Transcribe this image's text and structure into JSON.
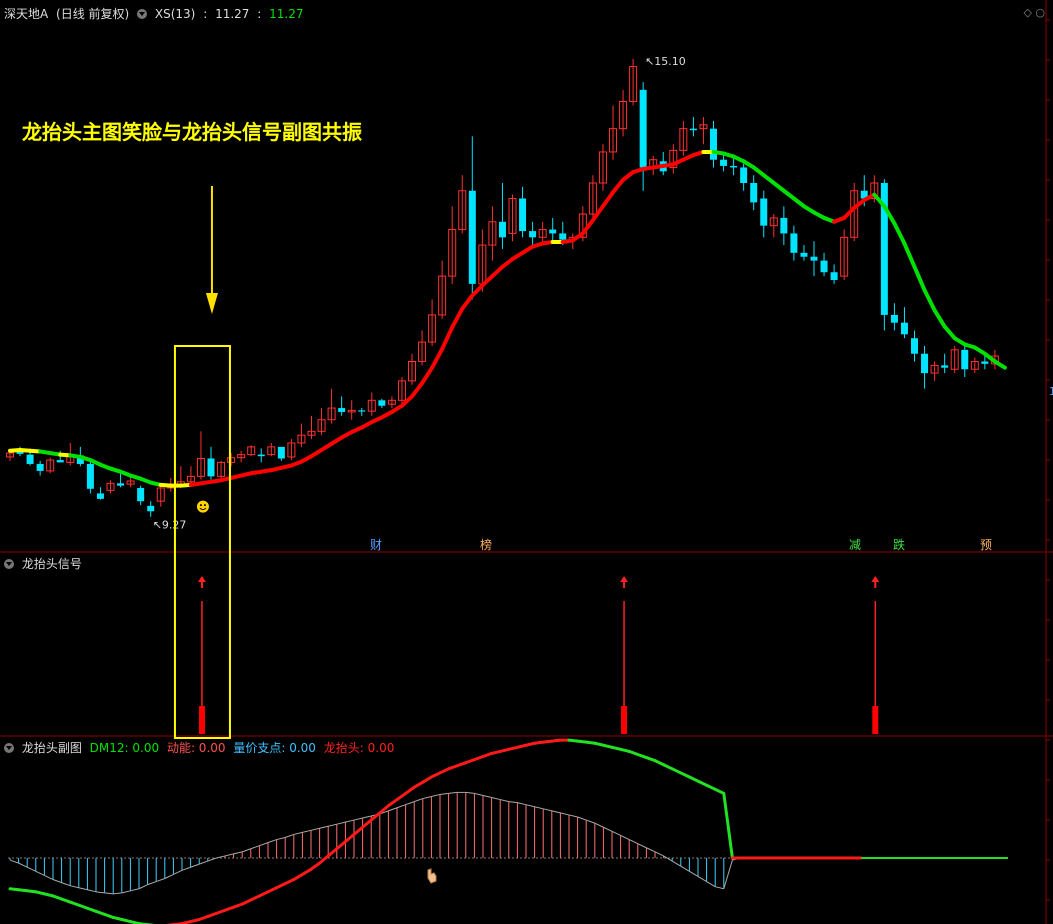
{
  "header": {
    "stock_name": "深天地A",
    "period": "(日线 前复权)",
    "indicator_name": "XS(13)",
    "indicator_values": [
      "11.27",
      "11.27"
    ]
  },
  "annotation": "龙抬头主图笑脸与龙抬头信号副图共振",
  "high_label": "15.10",
  "low_label": "9.27",
  "events": [
    "财",
    "榜",
    "减",
    "跌",
    "预"
  ],
  "right_tag": "1",
  "panel2": {
    "title": "龙抬头信号"
  },
  "panel3": {
    "title": "龙抬头副图",
    "legend": [
      {
        "label": "DM12: 0.00",
        "color": "#00e000"
      },
      {
        "label": "动能: 0.00",
        "color": "#ff5050"
      },
      {
        "label": "量价支点: 0.00",
        "color": "#40c0ff"
      },
      {
        "label": "龙抬头: 0.00",
        "color": "#ff2020"
      }
    ]
  },
  "colors": {
    "up": "#ff3030",
    "down": "#00e5ff",
    "ma_up": "#ff0000",
    "ma_down": "#00e000",
    "ma_flat": "#ffff00",
    "box": "#ffff00"
  },
  "chart_data": {
    "type": "candlestick",
    "ylim": [
      8.9,
      15.6
    ],
    "candles": [
      [
        9.97,
        10.05,
        9.92,
        10.02
      ],
      [
        10.05,
        10.1,
        9.98,
        10.01
      ],
      [
        10.0,
        10.04,
        9.86,
        9.88
      ],
      [
        9.88,
        9.92,
        9.73,
        9.79
      ],
      [
        9.79,
        9.96,
        9.76,
        9.93
      ],
      [
        9.93,
        10.05,
        9.9,
        9.9
      ],
      [
        9.9,
        10.15,
        9.86,
        9.98
      ],
      [
        9.99,
        10.1,
        9.85,
        9.88
      ],
      [
        9.88,
        9.95,
        9.5,
        9.56
      ],
      [
        9.5,
        9.58,
        9.42,
        9.43
      ],
      [
        9.54,
        9.67,
        9.5,
        9.63
      ],
      [
        9.63,
        9.8,
        9.58,
        9.6
      ],
      [
        9.62,
        9.73,
        9.58,
        9.66
      ],
      [
        9.57,
        9.6,
        9.35,
        9.4
      ],
      [
        9.34,
        9.4,
        9.2,
        9.27
      ],
      [
        9.4,
        9.6,
        9.33,
        9.57
      ],
      [
        9.57,
        9.7,
        9.52,
        9.6
      ],
      [
        9.62,
        9.85,
        9.58,
        9.65
      ],
      [
        9.65,
        9.85,
        9.62,
        9.72
      ],
      [
        9.72,
        10.3,
        9.68,
        9.95
      ],
      [
        9.95,
        10.1,
        9.68,
        9.72
      ],
      [
        9.72,
        9.92,
        9.68,
        9.9
      ],
      [
        9.9,
        10.02,
        9.85,
        9.96
      ],
      [
        9.96,
        10.05,
        9.9,
        10.0
      ],
      [
        10.0,
        10.12,
        9.98,
        10.1
      ],
      [
        10.0,
        10.08,
        9.9,
        9.98
      ],
      [
        10.0,
        10.15,
        9.98,
        10.1
      ],
      [
        10.1,
        10.08,
        9.92,
        9.95
      ],
      [
        9.97,
        10.2,
        9.93,
        10.15
      ],
      [
        10.15,
        10.4,
        10.1,
        10.25
      ],
      [
        10.25,
        10.5,
        10.2,
        10.3
      ],
      [
        10.3,
        10.6,
        10.25,
        10.45
      ],
      [
        10.45,
        10.85,
        10.4,
        10.6
      ],
      [
        10.6,
        10.75,
        10.5,
        10.55
      ],
      [
        10.55,
        10.7,
        10.45,
        10.57
      ],
      [
        10.57,
        10.6,
        10.5,
        10.56
      ],
      [
        10.56,
        10.8,
        10.5,
        10.7
      ],
      [
        10.7,
        10.72,
        10.6,
        10.63
      ],
      [
        10.65,
        10.75,
        10.6,
        10.7
      ],
      [
        10.7,
        11.0,
        10.65,
        10.95
      ],
      [
        10.95,
        11.3,
        10.9,
        11.2
      ],
      [
        11.2,
        11.6,
        11.15,
        11.45
      ],
      [
        11.45,
        12.0,
        11.4,
        11.8
      ],
      [
        11.8,
        12.5,
        11.75,
        12.3
      ],
      [
        12.3,
        13.2,
        12.2,
        12.9
      ],
      [
        12.9,
        13.6,
        12.85,
        13.4
      ],
      [
        13.4,
        14.1,
        12.0,
        12.2
      ],
      [
        12.2,
        12.9,
        12.1,
        12.7
      ],
      [
        12.7,
        13.2,
        12.5,
        13.0
      ],
      [
        13.0,
        13.5,
        12.65,
        12.8
      ],
      [
        12.85,
        13.35,
        12.75,
        13.3
      ],
      [
        13.3,
        13.45,
        12.8,
        12.88
      ],
      [
        12.88,
        13.0,
        12.7,
        12.8
      ],
      [
        12.8,
        13.0,
        12.72,
        12.9
      ],
      [
        12.9,
        13.05,
        12.75,
        12.85
      ],
      [
        12.85,
        13.0,
        12.7,
        12.77
      ],
      [
        12.77,
        12.85,
        12.65,
        12.8
      ],
      [
        12.8,
        13.2,
        12.75,
        13.1
      ],
      [
        13.1,
        13.6,
        13.0,
        13.5
      ],
      [
        13.5,
        14.0,
        13.4,
        13.9
      ],
      [
        13.9,
        14.5,
        13.8,
        14.2
      ],
      [
        14.2,
        14.7,
        14.1,
        14.55
      ],
      [
        14.55,
        15.1,
        14.5,
        15.0
      ],
      [
        14.7,
        14.8,
        13.4,
        13.7
      ],
      [
        13.7,
        13.85,
        13.6,
        13.8
      ],
      [
        13.78,
        13.9,
        13.6,
        13.65
      ],
      [
        13.7,
        14.0,
        13.62,
        13.92
      ],
      [
        13.92,
        14.3,
        13.85,
        14.2
      ],
      [
        14.2,
        14.35,
        14.1,
        14.18
      ],
      [
        14.2,
        14.35,
        14.0,
        14.25
      ],
      [
        14.2,
        14.3,
        13.7,
        13.8
      ],
      [
        13.8,
        13.9,
        13.65,
        13.72
      ],
      [
        13.72,
        13.85,
        13.6,
        13.7
      ],
      [
        13.7,
        13.75,
        13.4,
        13.5
      ],
      [
        13.5,
        13.6,
        13.15,
        13.25
      ],
      [
        13.3,
        13.4,
        12.8,
        12.95
      ],
      [
        12.95,
        13.1,
        12.8,
        13.05
      ],
      [
        13.05,
        13.2,
        12.7,
        12.85
      ],
      [
        12.85,
        12.95,
        12.5,
        12.6
      ],
      [
        12.6,
        12.7,
        12.5,
        12.55
      ],
      [
        12.55,
        12.75,
        12.3,
        12.5
      ],
      [
        12.5,
        12.6,
        12.3,
        12.35
      ],
      [
        12.35,
        12.45,
        12.2,
        12.25
      ],
      [
        12.3,
        12.9,
        12.25,
        12.8
      ],
      [
        12.8,
        13.5,
        12.75,
        13.4
      ],
      [
        13.4,
        13.6,
        13.2,
        13.3
      ],
      [
        13.3,
        13.6,
        13.25,
        13.5
      ],
      [
        13.5,
        13.55,
        11.6,
        11.8
      ],
      [
        11.8,
        11.95,
        11.6,
        11.7
      ],
      [
        11.7,
        11.9,
        11.5,
        11.55
      ],
      [
        11.5,
        11.6,
        11.2,
        11.3
      ],
      [
        11.3,
        11.4,
        10.85,
        11.05
      ],
      [
        11.05,
        11.2,
        10.95,
        11.15
      ],
      [
        11.15,
        11.3,
        11.05,
        11.12
      ],
      [
        11.1,
        11.4,
        11.05,
        11.35
      ],
      [
        11.35,
        11.45,
        11.0,
        11.1
      ],
      [
        11.1,
        11.25,
        11.05,
        11.2
      ],
      [
        11.2,
        11.28,
        11.1,
        11.17
      ],
      [
        11.17,
        11.35,
        11.1,
        11.27
      ]
    ],
    "ma": [
      10.05,
      10.06,
      10.05,
      10.04,
      10.02,
      10.0,
      9.99,
      9.97,
      9.93,
      9.87,
      9.82,
      9.78,
      9.73,
      9.69,
      9.64,
      9.61,
      9.6,
      9.6,
      9.61,
      9.63,
      9.65,
      9.67,
      9.7,
      9.73,
      9.76,
      9.78,
      9.8,
      9.83,
      9.86,
      9.91,
      9.98,
      10.06,
      10.14,
      10.22,
      10.29,
      10.35,
      10.42,
      10.48,
      10.55,
      10.63,
      10.75,
      10.92,
      11.12,
      11.36,
      11.64,
      11.88,
      12.05,
      12.18,
      12.3,
      12.42,
      12.52,
      12.6,
      12.68,
      12.72,
      12.74,
      12.74,
      12.76,
      12.85,
      13.02,
      13.2,
      13.38,
      13.54,
      13.64,
      13.68,
      13.7,
      13.72,
      13.74,
      13.8,
      13.86,
      13.9,
      13.9,
      13.88,
      13.84,
      13.78,
      13.7,
      13.6,
      13.5,
      13.4,
      13.3,
      13.2,
      13.12,
      13.05,
      13.0,
      13.05,
      13.18,
      13.28,
      13.35,
      13.2,
      12.98,
      12.72,
      12.42,
      12.12,
      11.86,
      11.65,
      11.5,
      11.42,
      11.38,
      11.3,
      11.2,
      11.12
    ],
    "signal_days": [
      19,
      61,
      86
    ],
    "sub_panel": {
      "dongneng_ylim": [
        -10,
        12
      ],
      "dongneng": [
        -0.2,
        -0.5,
        -0.9,
        -1.3,
        -1.7,
        -2.1,
        -2.4,
        -2.7,
        -2.9,
        -3.1,
        -3.3,
        -3.4,
        -3.5,
        -3.4,
        -3.2,
        -3.0,
        -2.6,
        -2.3,
        -2.0,
        -1.6,
        -1.2,
        -0.9,
        -0.6,
        -0.3,
        0.0,
        0.2,
        0.4,
        0.6,
        0.9,
        1.2,
        1.5,
        1.8,
        2.0,
        2.3,
        2.5,
        2.7,
        2.9,
        3.1,
        3.3,
        3.5,
        3.7,
        3.9,
        4.1,
        4.3,
        4.6,
        4.9,
        5.2,
        5.5,
        5.8,
        6.0,
        6.2,
        6.3,
        6.4,
        6.4,
        6.3,
        6.1,
        5.9,
        5.7,
        5.5,
        5.4,
        5.2,
        5.0,
        4.8,
        4.6,
        4.4,
        4.2,
        4.0,
        3.7,
        3.4,
        3.0,
        2.6,
        2.2,
        1.8,
        1.4,
        1.0,
        0.6,
        0.2,
        -0.3,
        -0.8,
        -1.3,
        -1.8,
        -2.3,
        -2.8,
        -3.0,
        -0.2,
        0,
        0,
        0,
        0,
        0,
        0,
        0,
        0,
        0,
        0,
        0,
        0,
        0,
        0,
        0
      ],
      "dm12": [
        -3.0,
        -3.1,
        -3.2,
        -3.3,
        -3.5,
        -3.7,
        -4.0,
        -4.3,
        -4.6,
        -4.9,
        -5.2,
        -5.5,
        -5.8,
        -6.0,
        -6.2,
        -6.4,
        -6.5,
        -6.6,
        -6.6,
        -6.5,
        -6.4,
        -6.2,
        -6.0,
        -5.7,
        -5.4,
        -5.1,
        -4.8,
        -4.5,
        -4.1,
        -3.7,
        -3.3,
        -2.9,
        -2.5,
        -2.1,
        -1.6,
        -1.1,
        -0.5,
        0.2,
        0.9,
        1.6,
        2.3,
        3.0,
        3.7,
        4.4,
        5.1,
        5.7,
        6.3,
        6.9,
        7.4,
        7.9,
        8.3,
        8.7,
        9.0,
        9.3,
        9.6,
        9.9,
        10.2,
        10.4,
        10.6,
        10.8,
        11.0,
        11.2,
        11.3,
        11.4,
        11.5,
        11.5,
        11.4,
        11.3,
        11.2,
        11.0,
        10.8,
        10.6,
        10.4,
        10.1,
        9.8,
        9.5,
        9.1,
        8.7,
        8.3,
        7.9,
        7.5,
        7.1,
        6.7,
        6.3,
        0.0,
        0,
        0,
        0,
        0,
        0,
        0,
        0,
        0,
        0,
        0,
        0,
        0,
        0,
        0,
        0
      ]
    }
  }
}
